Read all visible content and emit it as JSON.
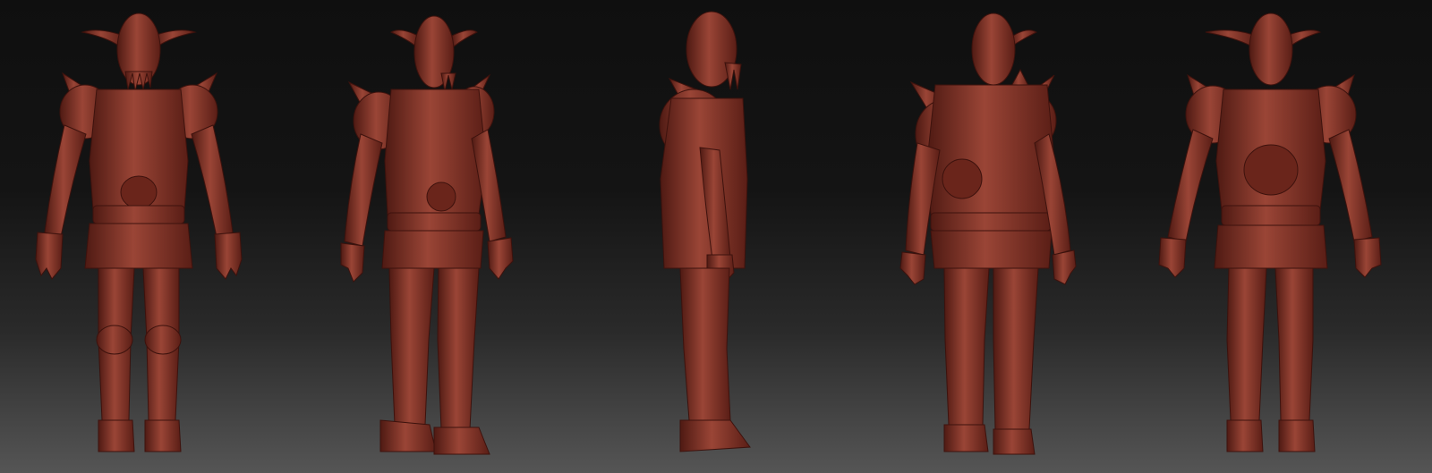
{
  "scene": {
    "background_top": "#0f0f0f",
    "background_bottom": "#555555",
    "material_color": "#7a2e22",
    "material_highlight": "#a24a3a",
    "material_shadow": "#4a1712",
    "views": [
      {
        "name": "front-view"
      },
      {
        "name": "three-quarter-front-view"
      },
      {
        "name": "side-view"
      },
      {
        "name": "three-quarter-back-view"
      },
      {
        "name": "back-view"
      }
    ]
  }
}
